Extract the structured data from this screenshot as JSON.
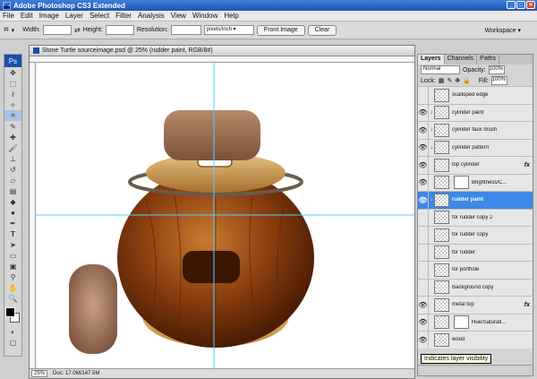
{
  "app": {
    "title": "Adobe Photoshop CS3 Extended",
    "icon": "Ps"
  },
  "menu": [
    "File",
    "Edit",
    "Image",
    "Layer",
    "Select",
    "Filter",
    "Analysis",
    "View",
    "Window",
    "Help"
  ],
  "options": {
    "width_label": "Width:",
    "height_label": "Height:",
    "resolution_label": "Resolution:",
    "resolution_unit": "pixels/inch",
    "front_image": "Front Image",
    "clear": "Clear",
    "workspace": "Workspace ▾"
  },
  "document": {
    "title": "Stone Turtle sourceimage.psd @ 25% (rudder paint, RGB/8#)",
    "zoom": "25%",
    "doc_size": "Doc: 17.0M/147.5M"
  },
  "layers_panel": {
    "tabs": [
      "Layers",
      "Channels",
      "Paths"
    ],
    "blend_mode": "Normal",
    "opacity_label": "Opacity:",
    "opacity": "100%",
    "lock_label": "Lock:",
    "fill_label": "Fill:",
    "fill": "100%",
    "layers": [
      {
        "name": "scalloped edge",
        "eye": false,
        "link": false,
        "fx": false,
        "mask": false,
        "selected": false
      },
      {
        "name": "cylinder paint",
        "eye": true,
        "link": true,
        "fx": false,
        "mask": false,
        "selected": false
      },
      {
        "name": "cylinder faux brush",
        "eye": true,
        "link": true,
        "fx": false,
        "mask": false,
        "selected": false
      },
      {
        "name": "cylinder pattern",
        "eye": true,
        "link": true,
        "fx": false,
        "mask": false,
        "selected": false
      },
      {
        "name": "top cylinder",
        "eye": true,
        "link": false,
        "fx": true,
        "mask": false,
        "selected": false
      },
      {
        "name": "Brightness/C...",
        "eye": true,
        "link": false,
        "fx": false,
        "mask": true,
        "selected": false
      },
      {
        "name": "rudder paint",
        "eye": true,
        "link": true,
        "fx": false,
        "mask": false,
        "selected": true
      },
      {
        "name": "for rudder copy 2",
        "eye": false,
        "link": false,
        "fx": false,
        "mask": false,
        "selected": false
      },
      {
        "name": "for rudder copy",
        "eye": false,
        "link": false,
        "fx": false,
        "mask": false,
        "selected": false
      },
      {
        "name": "for rudder",
        "eye": false,
        "link": false,
        "fx": false,
        "mask": false,
        "selected": false
      },
      {
        "name": "for porthole",
        "eye": false,
        "link": false,
        "fx": false,
        "mask": false,
        "selected": false
      },
      {
        "name": "Background copy",
        "eye": false,
        "link": false,
        "fx": false,
        "mask": false,
        "selected": false
      },
      {
        "name": "metal top",
        "eye": true,
        "link": false,
        "fx": true,
        "mask": false,
        "selected": false
      },
      {
        "name": "Hue/Saturati...",
        "eye": true,
        "link": false,
        "fx": false,
        "mask": true,
        "selected": false
      },
      {
        "name": "wood",
        "eye": true,
        "link": false,
        "fx": false,
        "mask": false,
        "selected": false
      }
    ]
  },
  "tooltip": "Indicates layer visibility",
  "colors": {
    "accent": "#3d88e8",
    "titlebar": "#1c54b8",
    "guide": "#55d0ff"
  }
}
